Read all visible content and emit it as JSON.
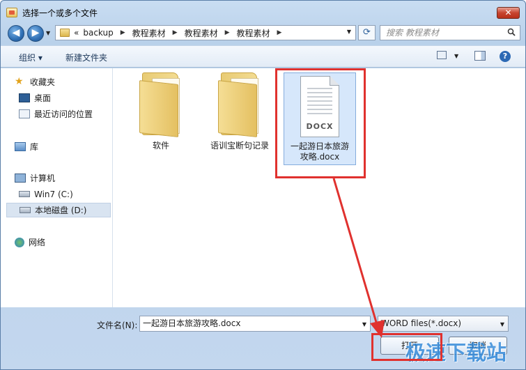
{
  "window": {
    "title": "选择一个或多个文件",
    "close_label": "✕"
  },
  "nav": {
    "back_glyph": "◀",
    "forward_glyph": "▶",
    "breadcrumb_prefix": "«",
    "breadcrumb": [
      "backup",
      "教程素材",
      "教程素材",
      "教程素材"
    ],
    "search_placeholder": "搜索 教程素材"
  },
  "toolbar": {
    "organize_label": "组织 ▾",
    "new_folder_label": "新建文件夹",
    "help_label": "?"
  },
  "sidebar": {
    "favorites": {
      "label": "收藏夹",
      "icon": "star-icon"
    },
    "favorite_items": [
      {
        "label": "桌面",
        "icon": "desktop-icon"
      },
      {
        "label": "最近访问的位置",
        "icon": "recent-places-icon"
      }
    ],
    "libraries": {
      "label": "库",
      "icon": "library-icon"
    },
    "computer": {
      "label": "计算机",
      "icon": "computer-icon"
    },
    "drives": [
      {
        "label": "Win7 (C:)",
        "icon": "system-drive-icon"
      },
      {
        "label": "本地磁盘 (D:)",
        "icon": "drive-icon",
        "selected": true
      }
    ],
    "network": {
      "label": "网络",
      "icon": "network-icon"
    }
  },
  "files": [
    {
      "name": "软件",
      "type": "folder"
    },
    {
      "name": "语训宝断句记录",
      "type": "folder"
    },
    {
      "name": "一起游日本旅游攻略.docx",
      "type": "docx",
      "badge": "DOCX",
      "selected": true
    }
  ],
  "bottom": {
    "filename_label": "文件名(N):",
    "filename_value": "一起游日本旅游攻略.docx",
    "filter_value": "WORD files(*.docx)",
    "open_label": "打开",
    "cancel_label": "取消"
  },
  "watermark": "极速下载站",
  "colors": {
    "highlight_red": "#e0312e",
    "selection_blue": "#d6e7fb"
  }
}
